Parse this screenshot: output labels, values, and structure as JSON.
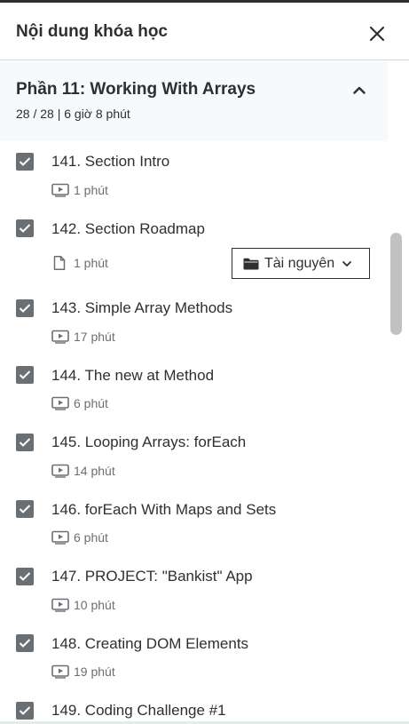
{
  "header": {
    "title": "Nội dung khóa học"
  },
  "section": {
    "title": "Phần 11: Working With Arrays",
    "meta": "28 / 28 | 6 giờ 8 phút"
  },
  "resources": {
    "label": "Tài nguyên"
  },
  "lessons": [
    {
      "title": "141. Section Intro",
      "duration": "1 phút",
      "type": "video",
      "checked": true
    },
    {
      "title": "142. Section Roadmap",
      "duration": "1 phút",
      "type": "document",
      "checked": true
    },
    {
      "title": "143. Simple Array Methods",
      "duration": "17 phút",
      "type": "video",
      "checked": true
    },
    {
      "title": "144. The new at Method",
      "duration": "6 phút",
      "type": "video",
      "checked": true
    },
    {
      "title": "145. Looping Arrays: forEach",
      "duration": "14 phút",
      "type": "video",
      "checked": true
    },
    {
      "title": "146. forEach With Maps and Sets",
      "duration": "6 phút",
      "type": "video",
      "checked": true
    },
    {
      "title": "147. PROJECT: \"Bankist\" App",
      "duration": "10 phút",
      "type": "video",
      "checked": true
    },
    {
      "title": "148. Creating DOM Elements",
      "duration": "19 phút",
      "type": "video",
      "checked": true
    },
    {
      "title": "149. Coding Challenge #1",
      "checked": true
    }
  ]
}
